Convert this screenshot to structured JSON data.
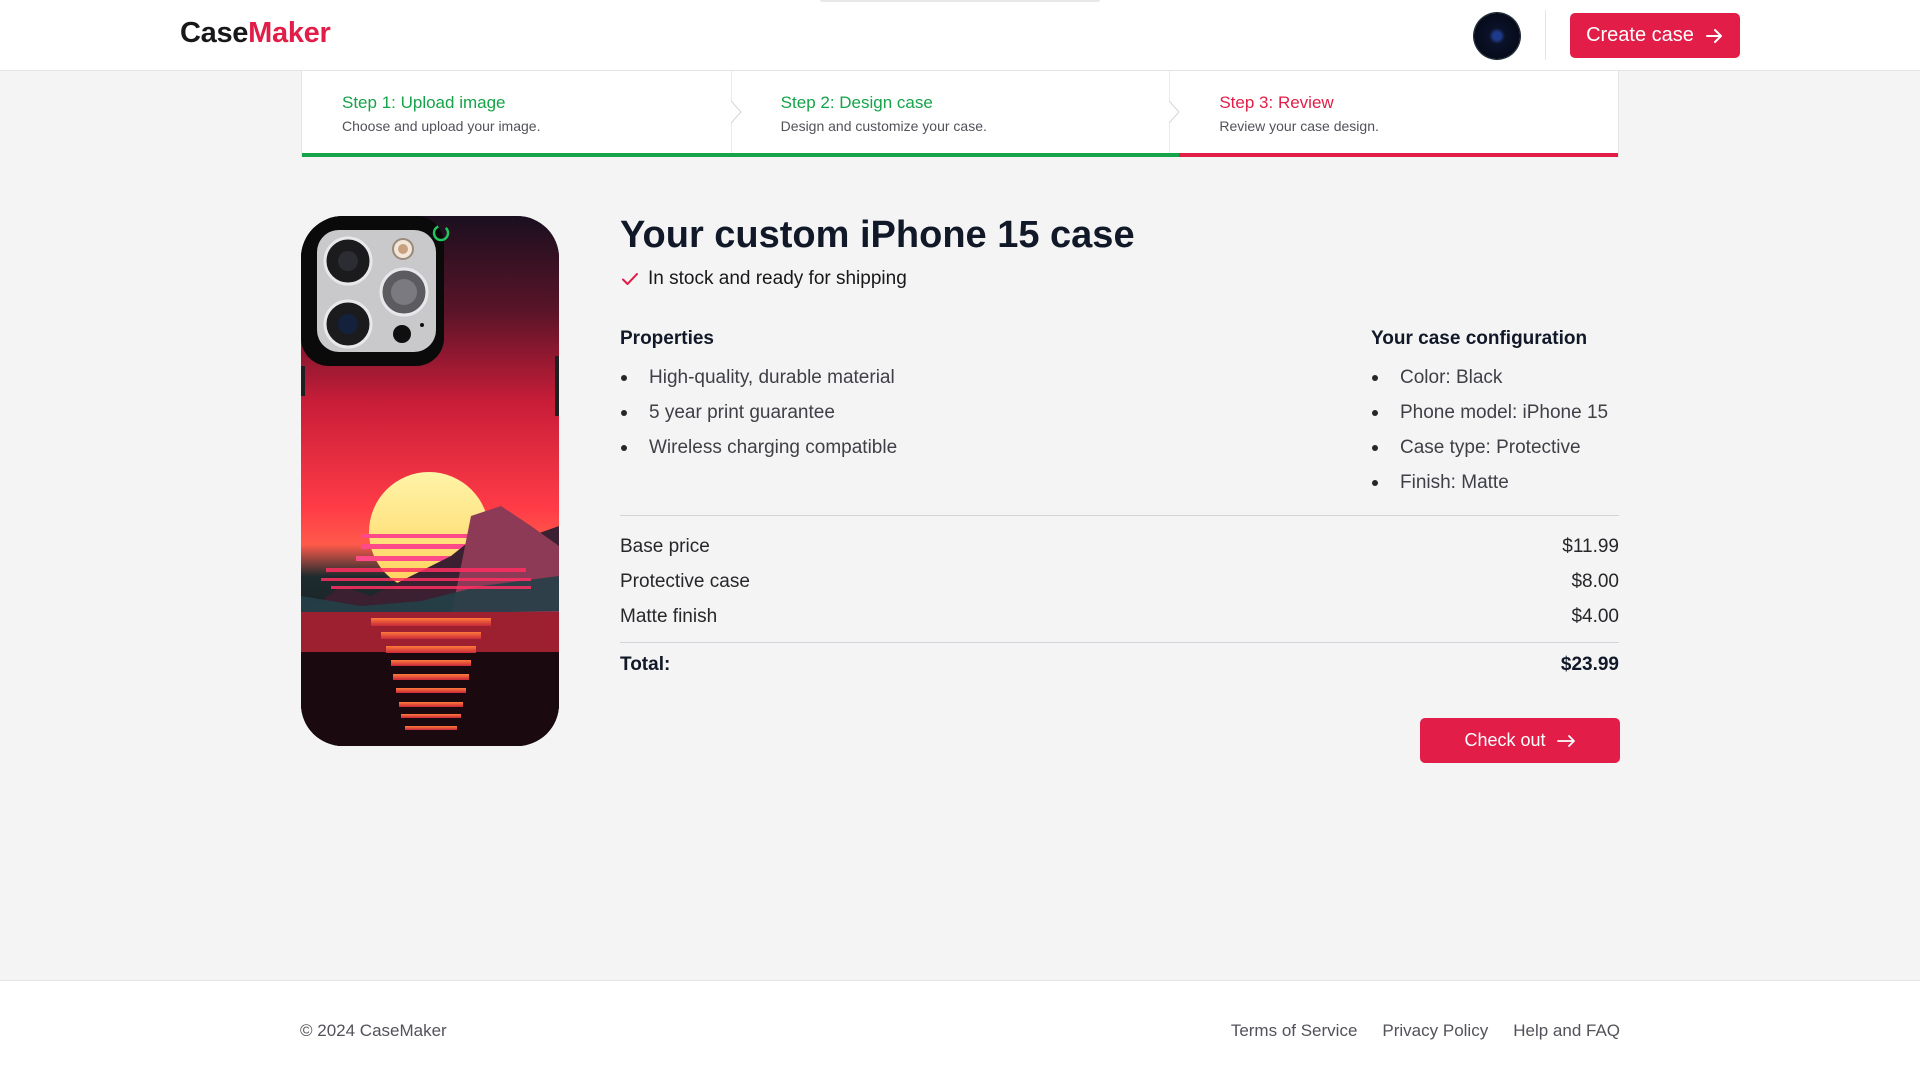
{
  "header": {
    "logo_part1": "Case",
    "logo_part2": "Maker",
    "create_button": "Create case"
  },
  "steps": [
    {
      "title": "Step 1: Upload image",
      "description": "Choose and upload your image.",
      "status": "complete"
    },
    {
      "title": "Step 2: Design case",
      "description": "Design and customize your case.",
      "status": "complete"
    },
    {
      "title": "Step 3: Review",
      "description": "Review your case design.",
      "status": "current"
    }
  ],
  "product": {
    "title": "Your custom iPhone 15 case",
    "stock_status": "In stock and ready for shipping"
  },
  "properties": {
    "heading": "Properties",
    "items": [
      "High-quality, durable material",
      "5 year print guarantee",
      "Wireless charging compatible"
    ]
  },
  "configuration": {
    "heading": "Your case configuration",
    "items": [
      "Color: Black",
      "Phone model: iPhone 15",
      "Case type: Protective",
      "Finish: Matte"
    ]
  },
  "pricing": {
    "rows": [
      {
        "label": "Base price",
        "value": "$11.99"
      },
      {
        "label": "Protective case",
        "value": "$8.00"
      },
      {
        "label": "Matte finish",
        "value": "$4.00"
      }
    ],
    "total_label": "Total:",
    "total_value": "$23.99"
  },
  "checkout_button": "Check out",
  "footer": {
    "copyright": "© 2024 CaseMaker",
    "links": [
      "Terms of Service",
      "Privacy Policy",
      "Help and FAQ"
    ]
  },
  "colors": {
    "brand": "#e11d48",
    "success": "#16a34a",
    "background": "#f4f4f5"
  }
}
